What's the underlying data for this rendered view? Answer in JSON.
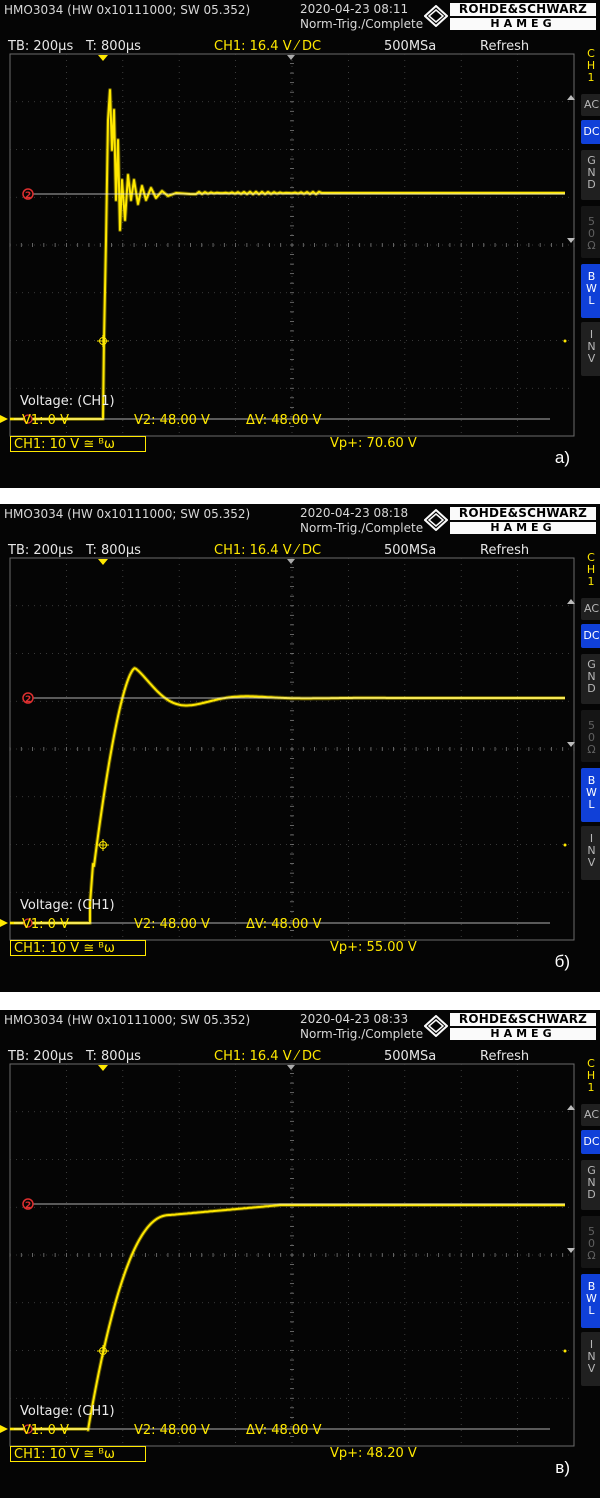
{
  "panels": [
    {
      "header": {
        "device": "HMO3034 (HW 0x10111000; SW 05.352)",
        "datetime": "2020-04-23 08:11",
        "trigger_mode": "Norm-Trig./Complete",
        "brand_top": "ROHDE&SCHWARZ",
        "brand_bottom": "HAMEG"
      },
      "status": {
        "timebase": "TB: 200µs",
        "trigger_time": "T: 800µs",
        "ch_setting": "CH1: 16.4 V ⁄ DC",
        "sample_rate": "500MSa",
        "acq_mode": "Refresh"
      },
      "side_buttons": {
        "ch_tab": "CH 1",
        "ac": "AC",
        "dc": "DC",
        "gnd": "GND",
        "ohm50": "50 Ω",
        "bwl": "BWL",
        "inv": "INV"
      },
      "cursors": {
        "title": "Voltage: (CH1)",
        "v1": "V1: 0 V",
        "v2": "V2: 48.00 V",
        "dv": "ΔV: 48.00 V",
        "ch_scale": "CH1: 10 V ≅ ᴮω",
        "vp_plus": "Vp+: 70.60 V"
      },
      "caption": "а)",
      "colors": {
        "trace": "#ffe800",
        "background": "#050505",
        "grid": "#6a6a6a",
        "cursor_marker": "#e03030"
      },
      "trace": {
        "type": "fast-oscillation",
        "peak_v": 70.6,
        "settle_v": 48
      }
    },
    {
      "header": {
        "device": "HMO3034 (HW 0x10111000; SW 05.352)",
        "datetime": "2020-04-23 08:18",
        "trigger_mode": "Norm-Trig./Complete",
        "brand_top": "ROHDE&SCHWARZ",
        "brand_bottom": "HAMEG"
      },
      "status": {
        "timebase": "TB: 200µs",
        "trigger_time": "T: 800µs",
        "ch_setting": "CH1: 16.4 V ⁄ DC",
        "sample_rate": "500MSa",
        "acq_mode": "Refresh"
      },
      "side_buttons": {
        "ch_tab": "CH 1",
        "ac": "AC",
        "dc": "DC",
        "gnd": "GND",
        "ohm50": "50 Ω",
        "bwl": "BWL",
        "inv": "INV"
      },
      "cursors": {
        "title": "Voltage: (CH1)",
        "v1": "V1: 0 V",
        "v2": "V2: 48.00 V",
        "dv": "ΔV: 48.00 V",
        "ch_scale": "CH1: 10 V ≅ ᴮω",
        "vp_plus": "Vp+: 55.00 V"
      },
      "caption": "б)",
      "colors": {
        "trace": "#ffe800",
        "background": "#050505",
        "grid": "#6a6a6a",
        "cursor_marker": "#e03030"
      },
      "trace": {
        "type": "damped-overshoot",
        "peak_v": 55.0,
        "settle_v": 48
      }
    },
    {
      "header": {
        "device": "HMO3034 (HW 0x10111000; SW 05.352)",
        "datetime": "2020-04-23 08:33",
        "trigger_mode": "Norm-Trig./Complete",
        "brand_top": "ROHDE&SCHWARZ",
        "brand_bottom": "HAMEG"
      },
      "status": {
        "timebase": "TB: 200µs",
        "trigger_time": "T: 800µs",
        "ch_setting": "CH1: 16.4 V ⁄ DC",
        "sample_rate": "500MSa",
        "acq_mode": "Refresh"
      },
      "side_buttons": {
        "ch_tab": "CH 1",
        "ac": "AC",
        "dc": "DC",
        "gnd": "GND",
        "ohm50": "50 Ω",
        "bwl": "BWL",
        "inv": "INV"
      },
      "cursors": {
        "title": "Voltage: (CH1)",
        "v1": "V1: 0 V",
        "v2": "V2: 48.00 V",
        "dv": "ΔV: 48.00 V",
        "ch_scale": "CH1: 10 V ≅ ᴮω",
        "vp_plus": "Vp+: 48.20 V"
      },
      "caption": "в)",
      "colors": {
        "trace": "#ffe800",
        "background": "#050505",
        "grid": "#6a6a6a",
        "cursor_marker": "#e03030"
      },
      "trace": {
        "type": "overdamped",
        "peak_v": 48.2,
        "settle_v": 48
      }
    }
  ]
}
